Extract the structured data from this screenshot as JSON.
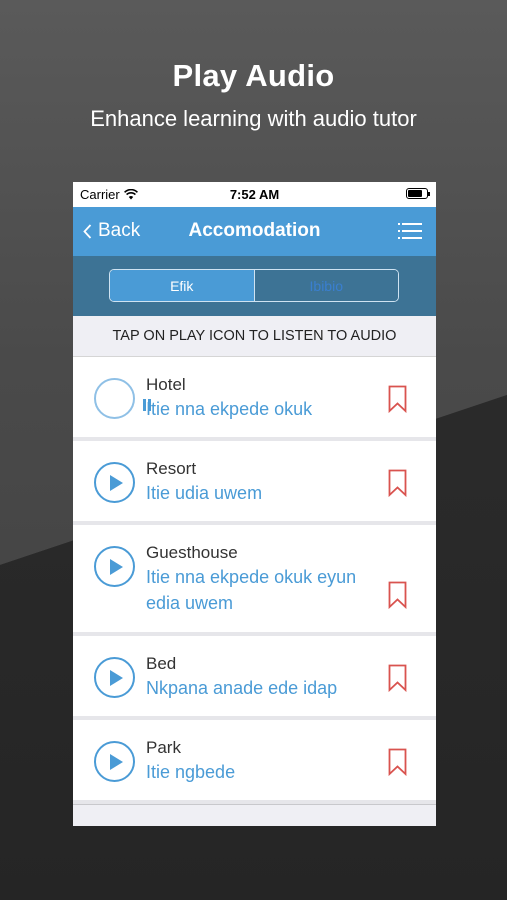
{
  "promo": {
    "title": "Play Audio",
    "subtitle": "Enhance learning with audio tutor"
  },
  "status_bar": {
    "carrier": "Carrier",
    "time": "7:52 AM"
  },
  "nav": {
    "back_label": "Back",
    "title": "Accomodation"
  },
  "segment": {
    "options": [
      "Efik",
      "Ibibio"
    ],
    "selected": "Efik"
  },
  "instruction": "TAP ON PLAY ICON TO LISTEN TO AUDIO",
  "items": [
    {
      "english": "Hotel",
      "translation": "Itie nna ekpede okuk",
      "state": "playing"
    },
    {
      "english": "Resort",
      "translation": "Itie udia uwem",
      "state": "idle"
    },
    {
      "english": "Guesthouse",
      "translation": "Itie nna ekpede okuk eyun edia uwem",
      "state": "idle"
    },
    {
      "english": "Bed",
      "translation": "Nkpana anade ede idap",
      "state": "idle"
    },
    {
      "english": "Park",
      "translation": "Itie ngbede",
      "state": "idle"
    }
  ],
  "colors": {
    "accent": "#4a9bd6",
    "segment_bg": "#3d7395",
    "bookmark": "#d9534f"
  }
}
